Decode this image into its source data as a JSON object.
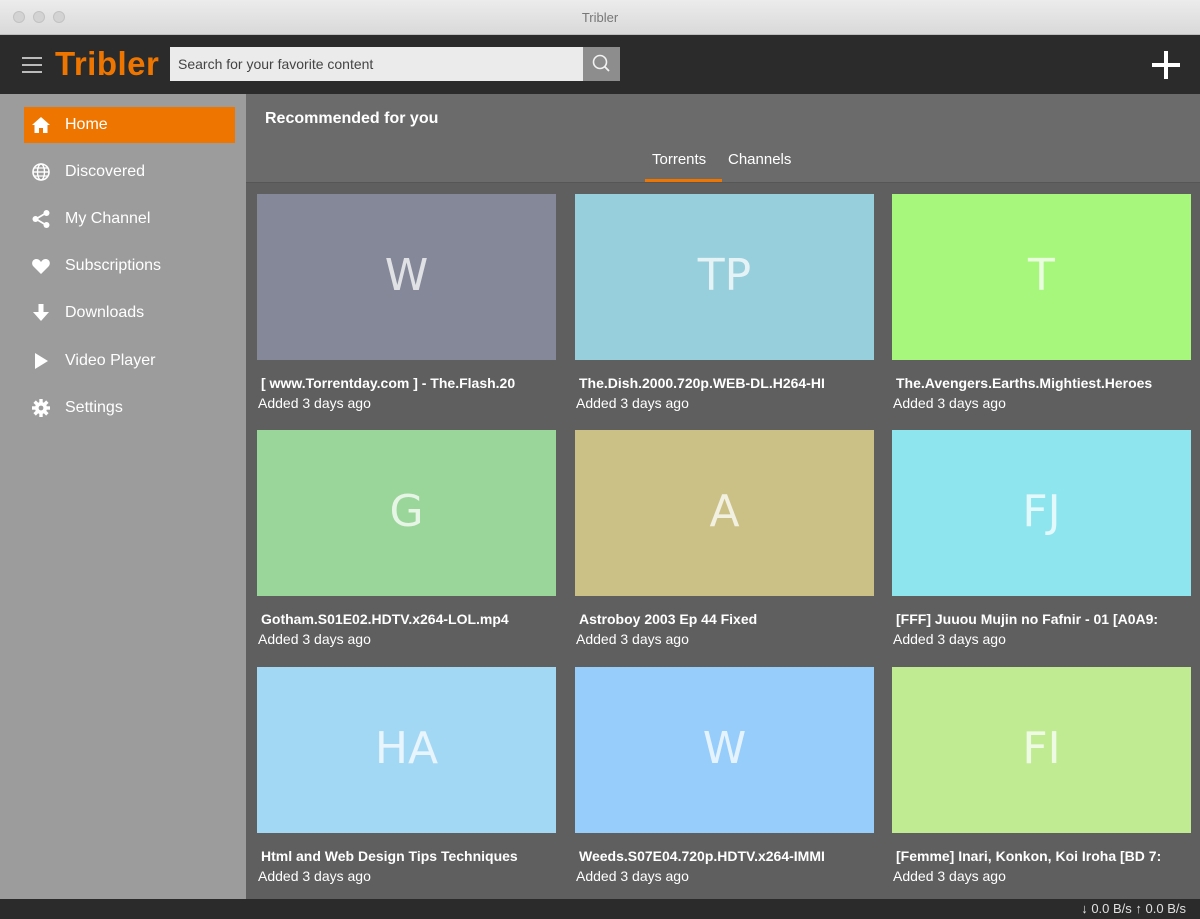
{
  "window": {
    "title": "Tribler"
  },
  "header": {
    "logo": "Tribler",
    "search_placeholder": "Search for your favorite content",
    "accent": "#ee7600"
  },
  "sidebar": {
    "items": [
      {
        "label": "Home",
        "icon": "home-icon",
        "active": true
      },
      {
        "label": "Discovered",
        "icon": "globe-icon",
        "active": false
      },
      {
        "label": "My Channel",
        "icon": "share-icon",
        "active": false
      },
      {
        "label": "Subscriptions",
        "icon": "heart-icon",
        "active": false
      },
      {
        "label": "Downloads",
        "icon": "arrow-down-icon",
        "active": false
      },
      {
        "label": "Video Player",
        "icon": "play-icon",
        "active": false
      },
      {
        "label": "Settings",
        "icon": "gear-icon",
        "active": false
      }
    ]
  },
  "main": {
    "title": "Recommended for you",
    "tabs": [
      {
        "label": "Torrents",
        "active": true
      },
      {
        "label": "Channels",
        "active": false
      }
    ],
    "cards": [
      {
        "initials": "W",
        "name": "[ www.Torrentday.com ] - The.Flash.20",
        "added": "Added 3 days ago",
        "color": "#858898"
      },
      {
        "initials": "TP",
        "name": "The.Dish.2000.720p.WEB-DL.H264-HI",
        "added": "Added 3 days ago",
        "color": "#97cfdc"
      },
      {
        "initials": "T",
        "name": "The.Avengers.Earths.Mightiest.Heroes",
        "added": "Added 3 days ago",
        "color": "#a8f77d"
      },
      {
        "initials": "G",
        "name": "Gotham.S01E02.HDTV.x264-LOL.mp4",
        "added": "Added 3 days ago",
        "color": "#9ad599"
      },
      {
        "initials": "A",
        "name": "Astroboy 2003 Ep 44 Fixed",
        "added": "Added 3 days ago",
        "color": "#cbc187"
      },
      {
        "initials": "FJ",
        "name": "[FFF] Juuou Mujin no Fafnir - 01 [A0A9:",
        "added": "Added 3 days ago",
        "color": "#8ee5ee"
      },
      {
        "initials": "HA",
        "name": "Html and Web Design Tips Techniques",
        "added": "Added 3 days ago",
        "color": "#a3d8f5"
      },
      {
        "initials": "W",
        "name": "Weeds.S07E04.720p.HDTV.x264-IMMI",
        "added": "Added 3 days ago",
        "color": "#96cdfb"
      },
      {
        "initials": "FI",
        "name": "[Femme] Inari, Konkon, Koi Iroha [BD 7:",
        "added": "Added 3 days ago",
        "color": "#c0eb93"
      }
    ]
  },
  "status": {
    "download": "↓ 0.0 B/s",
    "upload": "↑ 0.0 B/s"
  }
}
